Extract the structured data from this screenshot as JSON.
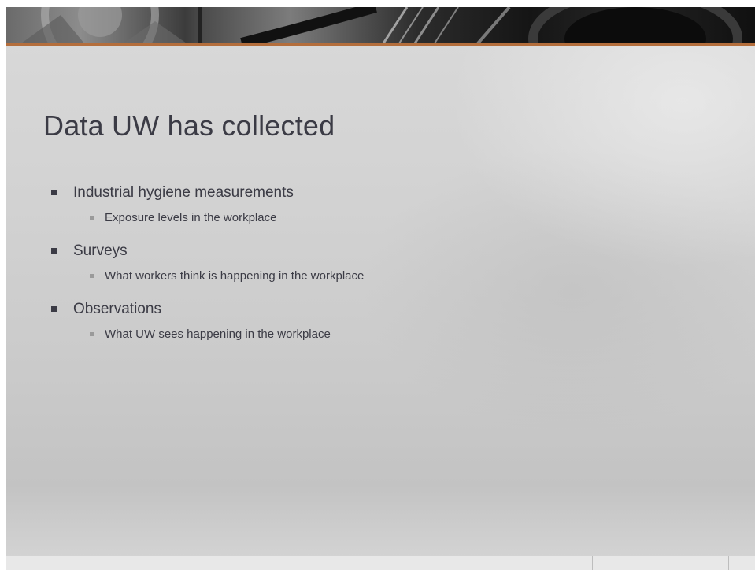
{
  "slide": {
    "title": "Data UW has collected",
    "bullets": [
      {
        "text": "Industrial hygiene measurements",
        "sub": "Exposure levels in the workplace"
      },
      {
        "text": "Surveys",
        "sub": "What workers think is happening in the workplace"
      },
      {
        "text": "Observations",
        "sub": "What UW sees happening in the workplace"
      }
    ]
  },
  "colors": {
    "accent_rule": "#b46e3c",
    "title_text": "#3b3b45",
    "background": "#d2d2d2"
  }
}
